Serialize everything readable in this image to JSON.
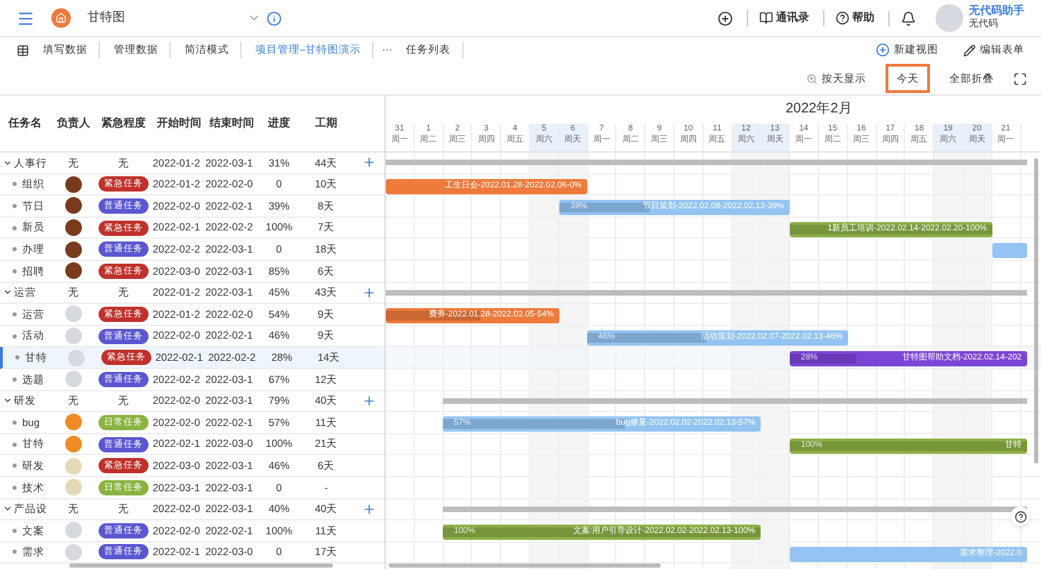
{
  "app": {
    "title": "甘特图"
  },
  "top_actions": [
    {
      "label": "通讯录",
      "kind": "contacts"
    },
    {
      "label": "帮助",
      "kind": "help"
    }
  ],
  "user": {
    "name": "无代码助手",
    "org": "无代码"
  },
  "tabs": [
    {
      "label": "填写数据",
      "selected": false
    },
    {
      "label": "管理数据",
      "selected": false
    },
    {
      "label": "简洁模式",
      "selected": false
    },
    {
      "label": "项目管理–甘特图演示",
      "selected": true
    },
    {
      "label": "任务列表",
      "selected": false
    }
  ],
  "more": "···",
  "view_actions": [
    {
      "label": "新建视图",
      "kind": "add"
    },
    {
      "label": "编辑表单",
      "kind": "edit"
    }
  ],
  "toolbar": [
    {
      "label": "按天显示",
      "kind": "scale",
      "selected": false
    },
    {
      "label": "今天",
      "kind": "today",
      "selected": true
    },
    {
      "label": "全部折叠",
      "kind": "collapse",
      "selected": false
    }
  ],
  "columns": [
    "任务名",
    "负责人",
    "紧急程度",
    "开始时间",
    "结束时间",
    "进度",
    "工期"
  ],
  "timeline": {
    "month": "2022年2月",
    "days": [
      {
        "day": "31",
        "weekday": "周一",
        "weekend": false
      },
      {
        "day": "1",
        "weekday": "周二",
        "weekend": false
      },
      {
        "day": "2",
        "weekday": "周三",
        "weekend": false
      },
      {
        "day": "3",
        "weekday": "周四",
        "weekend": false
      },
      {
        "day": "4",
        "weekday": "周五",
        "weekend": false
      },
      {
        "day": "5",
        "weekday": "周六",
        "weekend": true
      },
      {
        "day": "6",
        "weekday": "周天",
        "weekend": true
      },
      {
        "day": "7",
        "weekday": "周一",
        "weekend": false
      },
      {
        "day": "8",
        "weekday": "周二",
        "weekend": false
      },
      {
        "day": "9",
        "weekday": "周三",
        "weekend": false
      },
      {
        "day": "10",
        "weekday": "周四",
        "weekend": false
      },
      {
        "day": "11",
        "weekday": "周五",
        "weekend": false
      },
      {
        "day": "12",
        "weekday": "周六",
        "weekend": true
      },
      {
        "day": "13",
        "weekday": "周天",
        "weekend": true
      },
      {
        "day": "14",
        "weekday": "周一",
        "weekend": false
      },
      {
        "day": "15",
        "weekday": "周二",
        "weekend": false
      },
      {
        "day": "16",
        "weekday": "周三",
        "weekend": false
      },
      {
        "day": "17",
        "weekday": "周四",
        "weekend": false
      },
      {
        "day": "18",
        "weekday": "周五",
        "weekend": false
      },
      {
        "day": "19",
        "weekday": "周六",
        "weekend": true
      },
      {
        "day": "20",
        "weekday": "周天",
        "weekend": true
      },
      {
        "day": "21",
        "weekday": "周一",
        "weekend": false
      }
    ]
  },
  "groups": [
    {
      "name": "人事行",
      "owner": {
        "kind": "none",
        "label": "无"
      },
      "priority": {
        "kind": "none",
        "label": "无"
      },
      "start": "2022-01-2",
      "end": "2022-03-1",
      "progress": "31%",
      "duration": "44天",
      "expanded": true,
      "selected": false,
      "bar": {
        "kind": "summary"
      },
      "children": [
        {
          "name": "组织",
          "owner": {
            "kind": "avatar",
            "color": "#7a3b1c"
          },
          "priority": {
            "kind": "tag",
            "label": "紧急任务",
            "color": "#c0312b"
          },
          "start": "2022-01-2",
          "end": "2022-02-0",
          "progress": "0",
          "duration": "10天",
          "selected": false,
          "bar": {
            "kind": "task",
            "label": "工生日会-2022.01.28-2022.02.06-0%",
            "color": "#ee7a3b"
          }
        },
        {
          "name": "节日",
          "owner": {
            "kind": "avatar",
            "color": "#7a3b1c"
          },
          "priority": {
            "kind": "tag",
            "label": "普通任务",
            "color": "#5b57d1"
          },
          "start": "2022-02-0",
          "end": "2022-02-1",
          "progress": "39%",
          "duration": "8天",
          "selected": false,
          "bar": {
            "kind": "task",
            "percent": "39%",
            "label": "节日策划-2022.02.08-2022.02.13-39%",
            "level": 0.39,
            "color": "#93c4f3"
          }
        },
        {
          "name": "新员",
          "owner": {
            "kind": "avatar",
            "color": "#7a3b1c"
          },
          "priority": {
            "kind": "tag",
            "label": "紧急任务",
            "color": "#c0312b"
          },
          "start": "2022-02-1",
          "end": "2022-02-2",
          "progress": "100%",
          "duration": "7天",
          "selected": false,
          "bar": {
            "kind": "task",
            "label": "1新员工培训-2022.02.14-2022.02.20-100%",
            "level": 1,
            "color": "#8db046"
          }
        },
        {
          "name": "办理",
          "owner": {
            "kind": "avatar",
            "color": "#7a3b1c"
          },
          "priority": {
            "kind": "tag",
            "label": "普通任务",
            "color": "#5b57d1"
          },
          "start": "2022-02-2",
          "end": "2022-03-1",
          "progress": "0",
          "duration": "18天",
          "selected": false,
          "bar": {
            "kind": "task",
            "color": "#93c4f3"
          }
        },
        {
          "name": "招聘",
          "owner": {
            "kind": "avatar",
            "color": "#7a3b1c"
          },
          "priority": {
            "kind": "tag",
            "label": "紧急任务",
            "color": "#c0312b"
          },
          "start": "2022-03-0",
          "end": "2022-03-1",
          "progress": "85%",
          "duration": "6天",
          "selected": false
        }
      ]
    },
    {
      "name": "运营",
      "owner": {
        "kind": "none",
        "label": "无"
      },
      "priority": {
        "kind": "none",
        "label": "无"
      },
      "start": "2022-01-2",
      "end": "2022-03-1",
      "progress": "45%",
      "duration": "43天",
      "expanded": true,
      "selected": false,
      "bar": {
        "kind": "summary"
      },
      "children": [
        {
          "name": "运营",
          "owner": {
            "kind": "avatar",
            "color": "#d6dae0"
          },
          "priority": {
            "kind": "tag",
            "label": "紧急任务",
            "color": "#c0312b"
          },
          "start": "2022-01-2",
          "end": "2022-02-0",
          "progress": "54%",
          "duration": "9天",
          "selected": false,
          "bar": {
            "kind": "task",
            "label": "费券-2022.01.28-2022.02.05-54%",
            "level": 0.54,
            "color": "#ee7a3b"
          }
        },
        {
          "name": "活动",
          "owner": {
            "kind": "avatar",
            "color": "#d6dae0"
          },
          "priority": {
            "kind": "tag",
            "label": "普通任务",
            "color": "#5b57d1"
          },
          "start": "2022-02-0",
          "end": "2022-02-1",
          "progress": "46%",
          "duration": "9天",
          "selected": false,
          "bar": {
            "kind": "task",
            "percent": "46%",
            "label": "活动策划-2022.02.07-2022.02.13-46%",
            "level": 0.46,
            "color": "#93c4f3"
          }
        },
        {
          "name": "甘特",
          "owner": {
            "kind": "avatar",
            "color": "#d6dae0"
          },
          "priority": {
            "kind": "tag",
            "label": "紧急任务",
            "color": "#c0312b"
          },
          "start": "2022-02-1",
          "end": "2022-02-2",
          "progress": "28%",
          "duration": "14天",
          "selected": true,
          "bar": {
            "kind": "task",
            "percent": "28%",
            "label": "甘特图帮助文档-2022.02.14-202",
            "level": 0.28,
            "color": "#7d45d6"
          }
        },
        {
          "name": "选题",
          "owner": {
            "kind": "avatar",
            "color": "#d6dae0"
          },
          "priority": {
            "kind": "tag",
            "label": "普通任务",
            "color": "#5b57d1"
          },
          "start": "2022-02-2",
          "end": "2022-03-1",
          "progress": "67%",
          "duration": "12天",
          "selected": false
        }
      ]
    },
    {
      "name": "研发",
      "owner": {
        "kind": "none",
        "label": "无"
      },
      "priority": {
        "kind": "none",
        "label": "无"
      },
      "start": "2022-02-0",
      "end": "2022-03-1",
      "progress": "79%",
      "duration": "40天",
      "expanded": true,
      "selected": false,
      "bar": {
        "kind": "summary"
      },
      "children": [
        {
          "name": "bug",
          "owner": {
            "kind": "avatar",
            "color": "#f08a24"
          },
          "priority": {
            "kind": "tag",
            "label": "日常任务",
            "color": "#8bb342"
          },
          "start": "2022-02-0",
          "end": "2022-02-1",
          "progress": "57%",
          "duration": "11天",
          "selected": false,
          "bar": {
            "kind": "task",
            "percent": "57%",
            "label": "bug修复-2022.02.02-2022.02.13-57%",
            "level": 0.57,
            "color": "#93c4f3"
          }
        },
        {
          "name": "甘特",
          "owner": {
            "kind": "avatar",
            "color": "#f08a24"
          },
          "priority": {
            "kind": "tag",
            "label": "普通任务",
            "color": "#5b57d1"
          },
          "start": "2022-02-1",
          "end": "2022-03-0",
          "progress": "100%",
          "duration": "21天",
          "selected": false,
          "bar": {
            "kind": "task",
            "percent": "100%",
            "label": "甘特",
            "level": 1,
            "color": "#8db046"
          }
        },
        {
          "name": "研发",
          "owner": {
            "kind": "avatar",
            "color": "#e6d9b8"
          },
          "priority": {
            "kind": "tag",
            "label": "紧急任务",
            "color": "#c0312b"
          },
          "start": "2022-03-0",
          "end": "2022-03-1",
          "progress": "46%",
          "duration": "6天",
          "selected": false
        },
        {
          "name": "技术",
          "owner": {
            "kind": "avatar",
            "color": "#e6d9b8"
          },
          "priority": {
            "kind": "tag",
            "label": "日常任务",
            "color": "#8bb342"
          },
          "start": "2022-03-1",
          "end": "2022-03-1",
          "progress": "0",
          "duration": "-",
          "selected": false
        }
      ]
    },
    {
      "name": "产品设",
      "owner": {
        "kind": "none",
        "label": "无"
      },
      "priority": {
        "kind": "none",
        "label": "无"
      },
      "start": "2022-02-0",
      "end": "2022-03-1",
      "progress": "40%",
      "duration": "40天",
      "expanded": true,
      "selected": false,
      "bar": {
        "kind": "summary"
      },
      "children": [
        {
          "name": "文案",
          "owner": {
            "kind": "avatar",
            "color": "#d6dae0"
          },
          "priority": {
            "kind": "tag",
            "label": "普通任务",
            "color": "#5b57d1"
          },
          "start": "2022-02-0",
          "end": "2022-02-1",
          "progress": "100%",
          "duration": "11天",
          "selected": false,
          "bar": {
            "kind": "task",
            "percent": "100%",
            "label": "文案:用户引导设计-2022.02.02-2022.02.13-100%",
            "level": 1,
            "color": "#8db046"
          }
        },
        {
          "name": "需求",
          "owner": {
            "kind": "avatar",
            "color": "#d6dae0"
          },
          "priority": {
            "kind": "tag",
            "label": "普通任务",
            "color": "#5b57d1"
          },
          "start": "2022-02-1",
          "end": "2022-03-0",
          "progress": "0",
          "duration": "17天",
          "selected": false,
          "bar": {
            "kind": "task",
            "label": "需求整理-2022.0",
            "color": "#93c4f3"
          }
        }
      ]
    }
  ]
}
